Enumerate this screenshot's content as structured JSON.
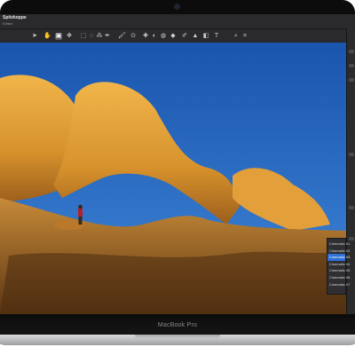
{
  "window": {
    "app_title": "Spitzkoppe",
    "app_subtitle": "Edited"
  },
  "toolbar": {
    "tools": [
      {
        "icon": "arrow-pointer-icon",
        "glyph": "➤"
      },
      {
        "icon": "hand-icon",
        "glyph": "✋"
      },
      {
        "icon": "selection-tool-icon",
        "glyph": "▣"
      },
      {
        "icon": "transform-icon",
        "glyph": "✥"
      },
      {
        "icon": "rectangle-select-icon",
        "glyph": "⬚"
      },
      {
        "icon": "lasso-icon",
        "glyph": "◌"
      },
      {
        "icon": "magic-select-icon",
        "glyph": "⁂"
      },
      {
        "icon": "pen-icon",
        "glyph": "✒"
      },
      {
        "icon": "brush-icon",
        "glyph": "🖌"
      },
      {
        "icon": "clone-icon",
        "glyph": "⊙"
      },
      {
        "icon": "heal-icon",
        "glyph": "✚"
      },
      {
        "icon": "dodge-icon",
        "glyph": "◐"
      },
      {
        "icon": "blur-icon",
        "glyph": "◍"
      },
      {
        "icon": "sharpen-icon",
        "glyph": "◆"
      },
      {
        "icon": "color-picker-icon",
        "glyph": "✐"
      },
      {
        "icon": "fill-icon",
        "glyph": "▲"
      },
      {
        "icon": "shape-icon",
        "glyph": "◧"
      },
      {
        "icon": "text-tool-icon",
        "glyph": "T"
      },
      {
        "icon": "zoom-icon",
        "glyph": "⌕"
      },
      {
        "icon": "crop-icon",
        "glyph": "⌗"
      }
    ]
  },
  "preset_menu": {
    "items": [
      "Cinematic 01",
      "Cinematic 02",
      "Cinematic 03",
      "Cinematic 04",
      "Cinematic 05",
      "Cinematic 06",
      "Cinematic 07"
    ],
    "selected_index": 2
  },
  "device": {
    "label": "MacBook Pro"
  },
  "colors": {
    "sky": "#1f5fb8",
    "rock": "#e0a23a",
    "selection": "#2f6fd6"
  }
}
